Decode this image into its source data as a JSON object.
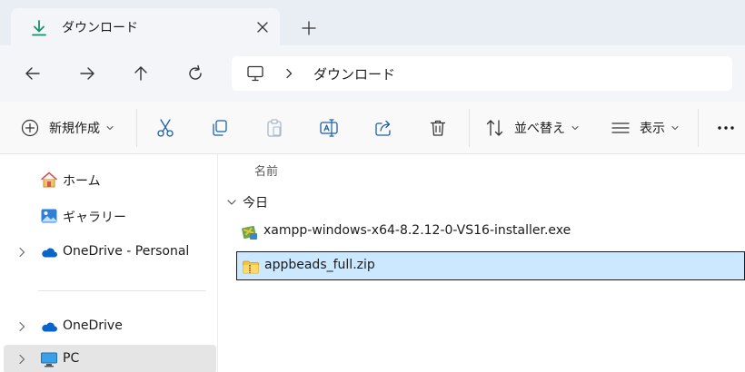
{
  "tab": {
    "title": "ダウンロード"
  },
  "address": {
    "crumb": "ダウンロード"
  },
  "toolbar": {
    "new_label": "新規作成",
    "sort_label": "並べ替え",
    "view_label": "表示"
  },
  "sidebar": {
    "items": [
      {
        "label": "ホーム",
        "icon": "home-icon"
      },
      {
        "label": "ギャラリー",
        "icon": "gallery-icon"
      },
      {
        "label": "OneDrive - Personal",
        "icon": "onedrive-icon"
      },
      {
        "label": "OneDrive",
        "icon": "onedrive-icon"
      },
      {
        "label": "PC",
        "icon": "pc-icon"
      }
    ]
  },
  "list": {
    "column_name": "名前",
    "group_label": "今日",
    "files": [
      {
        "name": "xampp-windows-x64-8.2.12-0-VS16-installer.exe",
        "icon": "installer-icon"
      },
      {
        "name": "appbeads_full.zip",
        "icon": "zip-folder-icon"
      }
    ]
  },
  "colors": {
    "accent": "#0078d4",
    "selection": "#cce8ff",
    "download": "#1a8f6b",
    "onedrive": "#0a64c8"
  }
}
